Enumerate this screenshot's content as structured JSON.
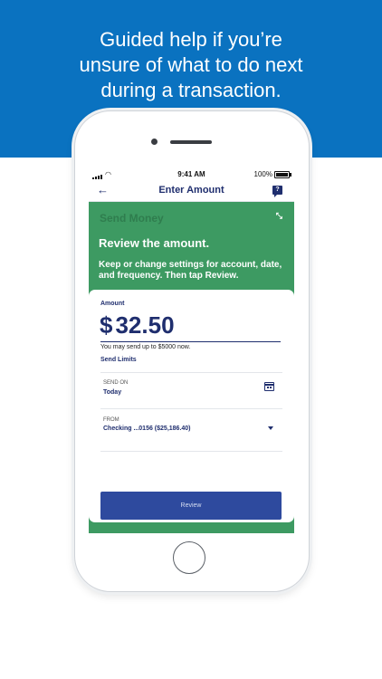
{
  "promo": {
    "headline_lines": [
      "Guided help if you’re",
      "unsure of what to do next",
      "during a transaction."
    ]
  },
  "status_bar": {
    "time": "9:41 AM",
    "battery": "100%"
  },
  "nav": {
    "title": "Enter Amount",
    "back_icon": "arrow-left-icon",
    "help_icon": "help-chat-icon",
    "help_glyph": "?"
  },
  "guide": {
    "background_title": "Send Money",
    "title": "Review the amount.",
    "text": "Keep or change settings for account, date, and frequency. Then tap Review."
  },
  "form": {
    "amount_label": "Amount",
    "currency": "$",
    "amount_value": "32.50",
    "limit_text": "You may send up to $5000 now.",
    "limits_link": "Send Limits",
    "send_on_label": "SEND ON",
    "send_on_value": "Today",
    "from_label": "FROM",
    "from_value": "Checking ...0156 ($25,186.40)",
    "review_button": "Review"
  },
  "colors": {
    "banner": "#0a72c0",
    "guide_green": "#3d9a62",
    "navy": "#1f2e6e",
    "button": "#2e4a9e"
  }
}
